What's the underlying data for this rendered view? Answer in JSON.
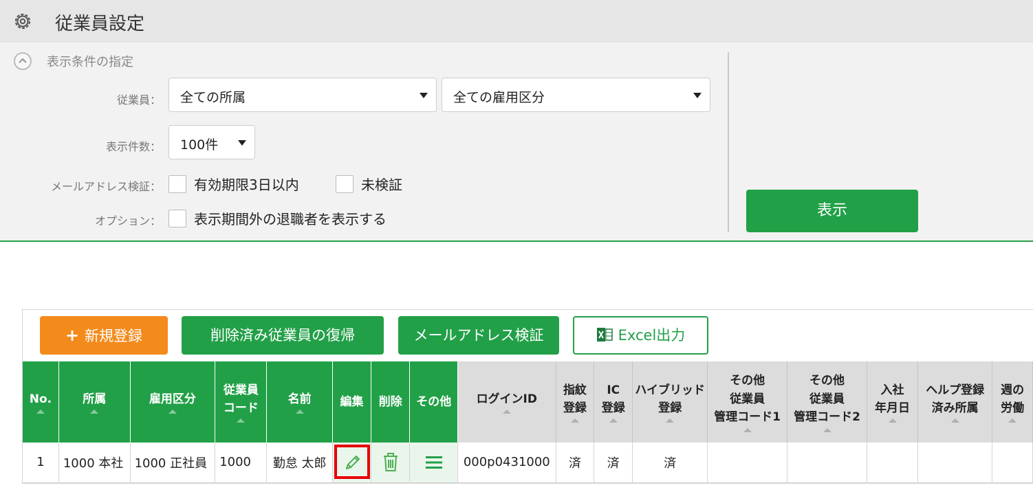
{
  "header": {
    "title": "従業員設定",
    "icon": "gear-icon"
  },
  "conditions": {
    "title": "表示条件の指定",
    "employee_label": "従業員：",
    "affiliation_select": "全ての所属",
    "employment_select": "全ての雇用区分",
    "count_label": "表示件数：",
    "count_select": "100件",
    "email_label": "メールアドレス検証：",
    "email_opt1": "有効期限3日以内",
    "email_opt2": "未検証",
    "option_label": "オプション：",
    "option_opt1": "表示期間外の退職者を表示する",
    "show_button": "表示"
  },
  "toolbar": {
    "new_label": "新規登録",
    "restore_label": "削除済み従業員の復帰",
    "email_verify_label": "メールアドレス検証",
    "excel_label": "Excel出力"
  },
  "table": {
    "headers": [
      "No.",
      "所属",
      "雇用区分",
      "従業員\nコード",
      "名前",
      "編集",
      "削除",
      "その他",
      "ログインID",
      "指紋\n登録",
      "IC\n登録",
      "ハイブリッド\n登録",
      "その他\n従業員\n管理コード1",
      "その他\n従業員\n管理コード2",
      "入社\n年月日",
      "ヘルプ登録\n済み所属",
      "週の\n労働"
    ],
    "rows": [
      {
        "no": "1",
        "affiliation": "1000 本社",
        "employment": "1000 正社員",
        "code": "1000",
        "name": "勤怠 太郎",
        "login_id": "000p0431000",
        "fingerprint": "済",
        "ic": "済",
        "hybrid": "済",
        "other1": "",
        "other2": "",
        "hire_date": "",
        "help": "",
        "weekly": ""
      }
    ]
  },
  "colors": {
    "accent_green": "#22a048",
    "orange": "#f38b1c",
    "highlight_red": "#e60000"
  }
}
